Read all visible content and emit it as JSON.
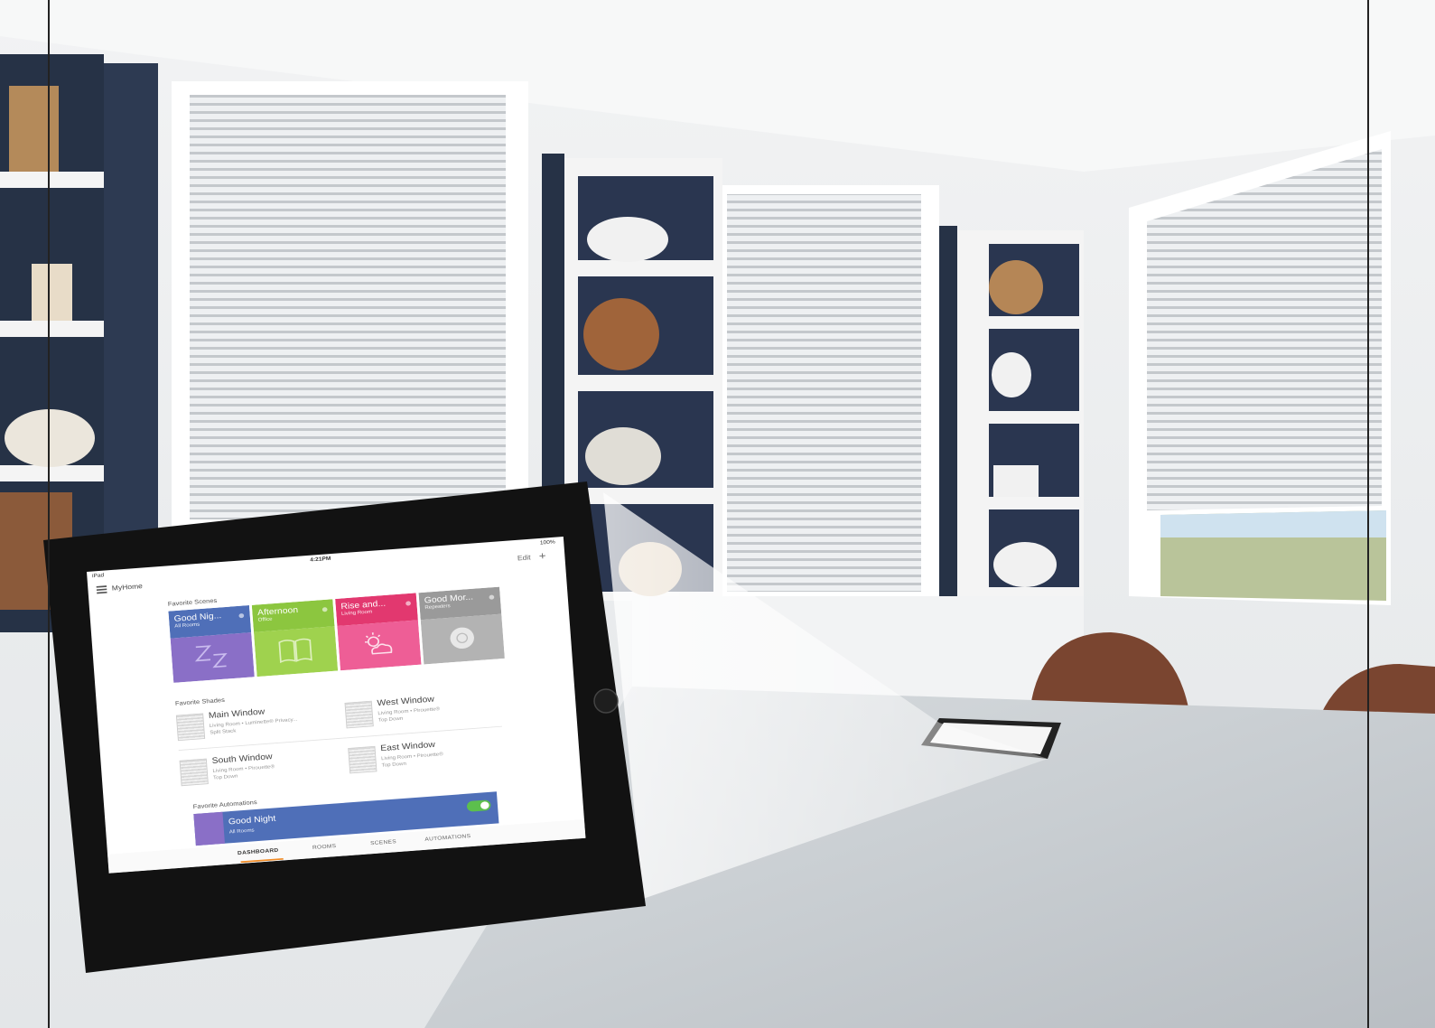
{
  "status_bar": {
    "carrier": "iPad",
    "time": "4:21PM",
    "battery": "100%"
  },
  "header": {
    "home_name": "MyHome",
    "edit_label": "Edit",
    "add_label": "+"
  },
  "favorite_scenes": {
    "title": "Favorite Scenes",
    "items": [
      {
        "name": "Good Nig...",
        "room": "All Rooms",
        "color": "#4f6fb8",
        "body_color": "#8a6fc7",
        "icon": "sleep-zz-icon"
      },
      {
        "name": "Afternoon",
        "room": "Office",
        "color": "#8cc63f",
        "body_color": "#9fd24e",
        "icon": "book-icon"
      },
      {
        "name": "Rise and...",
        "room": "Living Room",
        "color": "#e2386f",
        "body_color": "#ee5e96",
        "icon": "sun-cloud-icon"
      },
      {
        "name": "Good Mor...",
        "room": "Repeaters",
        "color": "#9a9a9a",
        "body_color": "#b3b3b3",
        "icon": "repeater-icon"
      }
    ]
  },
  "favorite_shades": {
    "title": "Favorite Shades",
    "items": [
      {
        "name": "Main Window",
        "detail": "Living Room • Luminette® Privacy...",
        "mode": "Split Stack"
      },
      {
        "name": "West Window",
        "detail": "Living Room • Pirouette®",
        "mode": "Top Down"
      },
      {
        "name": "South Window",
        "detail": "Living Room • Pirouette®",
        "mode": "Top Down"
      },
      {
        "name": "East Window",
        "detail": "Living Room • Pirouette®",
        "mode": "Top Down"
      }
    ]
  },
  "favorite_automations": {
    "title": "Favorite Automations",
    "item": {
      "name": "Good Night",
      "room": "All Rooms",
      "enabled": true
    }
  },
  "tabs": [
    "DASHBOARD",
    "ROOMS",
    "SCENES",
    "AUTOMATIONS"
  ],
  "active_tab": "DASHBOARD"
}
